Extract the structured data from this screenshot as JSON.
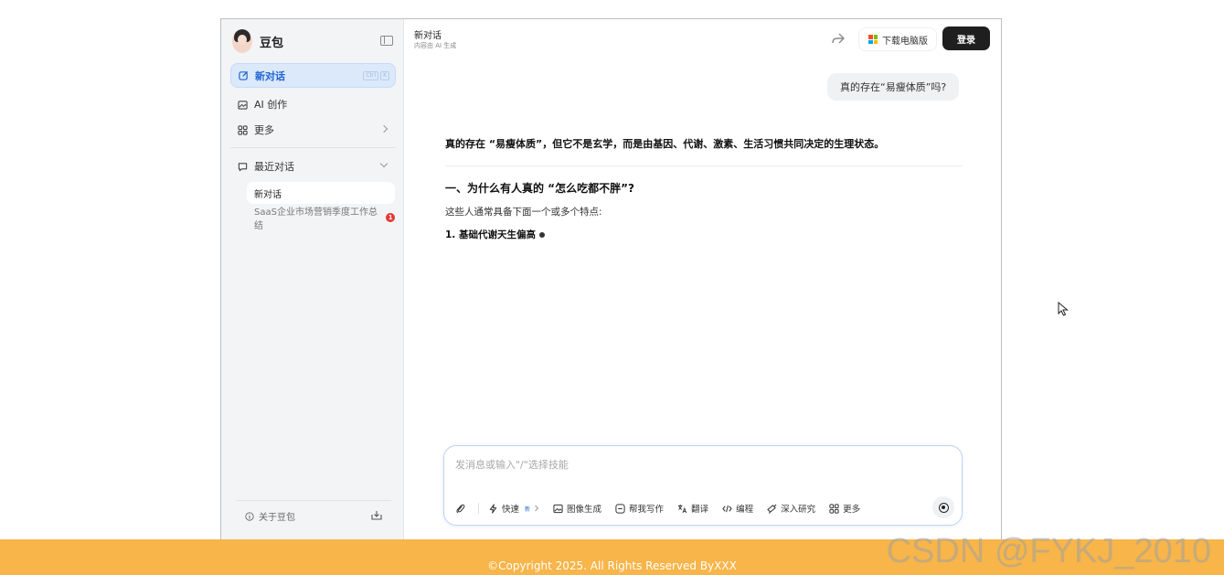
{
  "sidebar": {
    "brand": "豆包",
    "new_chat": "新对话",
    "new_chat_shortcut": [
      "Ctrl",
      "K"
    ],
    "items": [
      {
        "label": "AI 创作",
        "icon": "image-edit-icon"
      },
      {
        "label": "更多",
        "icon": "apps-icon"
      }
    ],
    "recent_label": "最近对话",
    "conversations": [
      {
        "title": "新对话",
        "active": true
      },
      {
        "title": "SaaS企业市场营销季度工作总结",
        "badge": "1"
      }
    ],
    "about": "关于豆包"
  },
  "header": {
    "title": "新对话",
    "subtitle": "内容由 AI 生成",
    "download_btn": "下载电脑版",
    "login_btn": "登录"
  },
  "chat": {
    "user_message": "真的存在“易瘦体质”吗?",
    "answer": {
      "lead": "真的存在 “易瘦体质”，但它不是玄学，而是由基因、代谢、激素、生活习惯共同决定的生理状态。",
      "heading": "一、为什么有人真的 “怎么吃都不胖”?",
      "paragraph": "这些人通常具备下面一个或多个特点:",
      "list_item": "1. 基础代谢天生偏高"
    }
  },
  "composer": {
    "placeholder": "发消息或输入\"/\"选择技能",
    "tools": [
      {
        "label": "快速",
        "icon": "bolt-icon",
        "tag": "新"
      },
      {
        "label": "图像生成",
        "icon": "image-icon"
      },
      {
        "label": "帮我写作",
        "icon": "write-icon"
      },
      {
        "label": "翻译",
        "icon": "translate-icon"
      },
      {
        "label": "编程",
        "icon": "code-icon"
      },
      {
        "label": "深入研究",
        "icon": "research-icon"
      },
      {
        "label": "更多",
        "icon": "grid-icon"
      }
    ]
  },
  "footer": {
    "copyright": "©Copyright 2025. All Rights Reserved ByXXX",
    "watermark": "CSDN @FYKJ_2010"
  },
  "colors": {
    "accent": "#1f63d1",
    "footer_bg": "#f7b54a",
    "login_bg": "#1f1f1f",
    "badge": "#e53935"
  }
}
